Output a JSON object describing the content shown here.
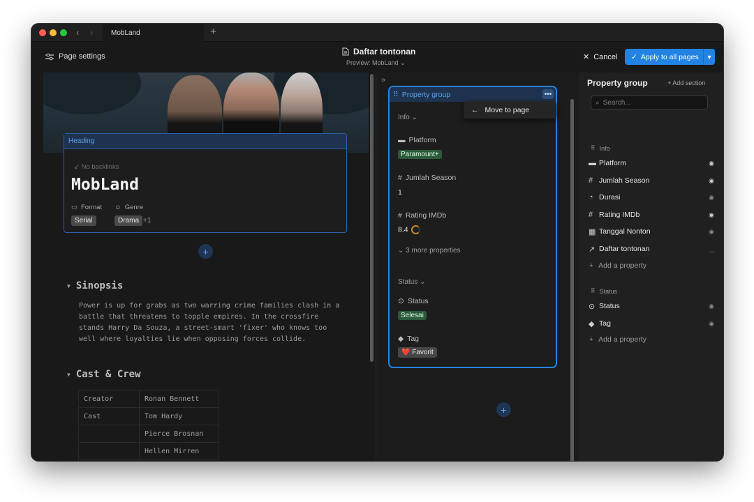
{
  "window": {
    "tab_title": "MobLand",
    "new_tab": "+",
    "nav_back": "‹",
    "nav_forward": "›"
  },
  "toolbar": {
    "page_settings": "Page settings",
    "doc_title": "Daftar tontonan",
    "preview": "Preview: MobLand",
    "cancel": "Cancel",
    "apply": "Apply to all pages"
  },
  "page": {
    "heading_label": "Heading",
    "backlinks": "No backlinks",
    "title": "MobLand",
    "format_label": "Format",
    "genre_label": "Genre",
    "format_value": "Serial",
    "genre_value": "Drama",
    "genre_more": "+1",
    "add": "+",
    "sinopsis_title": "Sinopsis",
    "sinopsis_text": "Power is up for grabs as two warring crime families clash in a battle that threatens to topple empires. In the crossfire stands Harry Da Souza, a street-smart 'fixer' who knows too well where loyalties lie when opposing forces collide.",
    "cast_title": "Cast & Crew",
    "cast_rows": [
      [
        "Creator",
        "Ronan Bennett"
      ],
      [
        "Cast",
        "Tom Hardy"
      ],
      [
        "",
        "Pierce Brosnan"
      ],
      [
        "",
        "Hellen Mirren"
      ]
    ]
  },
  "property_group": {
    "title": "Property group",
    "more": "•••",
    "menu_item": "Move to page",
    "info_section": "Info",
    "platform_label": "Platform",
    "platform_value": "Paramount+",
    "season_label": "Jumlah Season",
    "season_value": "1",
    "rating_label": "Rating IMDb",
    "rating_value": "8.4",
    "more_props": "3 more properties",
    "status_section": "Status",
    "status_label": "Status",
    "status_value": "Selesai",
    "tag_label": "Tag",
    "tag_value": "❤️ Favorit",
    "add": "+"
  },
  "right": {
    "title": "Property group",
    "add_section": "Add section",
    "search_placeholder": "Search...",
    "group_info": "Info",
    "info_items": [
      "Platform",
      "Jumlah Season",
      "Durasi",
      "Rating IMDb",
      "Tanggal Nonton",
      "Daftar tontonan"
    ],
    "add_property": "Add a property",
    "group_status": "Status",
    "status_items": [
      "Status",
      "Tag"
    ]
  },
  "colors": {
    "accent": "#2383e2",
    "green_tag": "#2b5a3b",
    "rating_ring": "#c98a2b"
  }
}
